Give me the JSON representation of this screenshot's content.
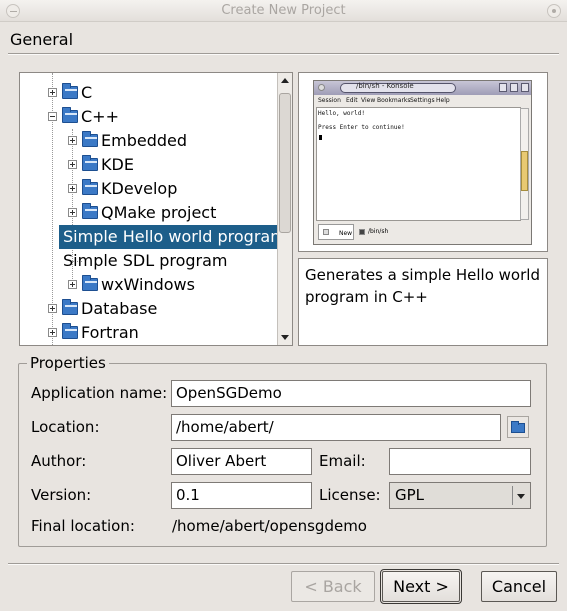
{
  "window": {
    "title": "Create New Project"
  },
  "page": {
    "title": "General"
  },
  "tree": {
    "items": [
      {
        "label": "C",
        "expander": "plus",
        "level": 0
      },
      {
        "label": "C++",
        "expander": "minus",
        "level": 0
      },
      {
        "label": "Embedded",
        "expander": "plus",
        "level": 1
      },
      {
        "label": "KDE",
        "expander": "plus",
        "level": 1
      },
      {
        "label": "KDevelop",
        "expander": "plus",
        "level": 1
      },
      {
        "label": "QMake project",
        "expander": "plus",
        "level": 1
      },
      {
        "label": "Simple Hello world program",
        "level": 1,
        "selected": true
      },
      {
        "label": "Simple SDL program",
        "level": 1
      },
      {
        "label": "wxWindows",
        "expander": "plus",
        "level": 1
      },
      {
        "label": "Database",
        "expander": "plus",
        "level": 0
      },
      {
        "label": "Fortran",
        "expander": "plus",
        "level": 0
      }
    ]
  },
  "preview": {
    "window_title": "/bin/sh - Konsole",
    "menu": [
      "Session",
      "Edit",
      "View",
      "Bookmarks",
      "Settings",
      "Help"
    ],
    "terminal_lines": [
      "Hello, world!",
      "Press Enter to continue!"
    ],
    "tabs": [
      "New",
      "/bin/sh"
    ]
  },
  "description": "Generates a simple Hello world program in C++",
  "properties": {
    "legend": "Properties",
    "app_name_label": "Application name:",
    "app_name_value": "OpenSGDemo",
    "location_label": "Location:",
    "location_value": "/home/abert/",
    "author_label": "Author:",
    "author_value": "Oliver Abert",
    "email_label": "Email:",
    "email_value": "",
    "version_label": "Version:",
    "version_value": "0.1",
    "license_label": "License:",
    "license_value": "GPL",
    "final_location_label": "Final location:",
    "final_location_value": "/home/abert/opensgdemo"
  },
  "buttons": {
    "back": "< Back",
    "next": "Next >",
    "cancel": "Cancel"
  },
  "colors": {
    "selection": "#1d5e8a",
    "folder": "#3b79c6",
    "background": "#e8e4e0"
  }
}
